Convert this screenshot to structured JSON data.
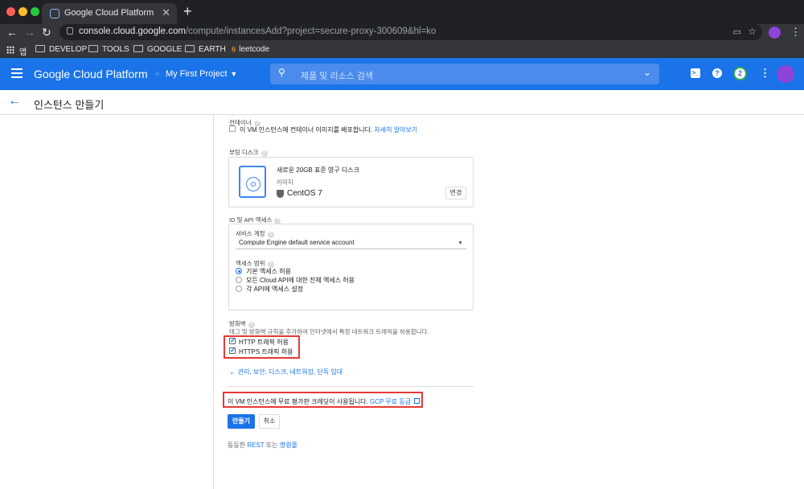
{
  "browser": {
    "tab_title": "Google Cloud Platform",
    "tab_close": "✕",
    "new_tab": "+",
    "url_domain": "console.cloud.google.com",
    "url_path": "/compute/instancesAdd?project=secure-proxy-300609&hl=ko",
    "bookmarks": [
      {
        "label": "앱"
      },
      {
        "label": "DEVELOP"
      },
      {
        "label": "TOOLS"
      },
      {
        "label": "GOOGLE"
      },
      {
        "label": "EARTH"
      },
      {
        "label": "leetcode"
      }
    ]
  },
  "header": {
    "title": "Google Cloud Platform",
    "project": "My First Project",
    "search_placeholder": "제품 및 리소스 검색",
    "notification_count": "2",
    "brand_color": "#1a73e8"
  },
  "page": {
    "title": "인스턴스 만들기"
  },
  "form": {
    "container": {
      "label": "컨테이너",
      "checkbox_text": "이 VM 인스턴스에 컨테이너 이미지를 배포합니다.",
      "learn_more": "자세히 알아보기",
      "checked": false
    },
    "boot_disk": {
      "label": "부팅 디스크",
      "disk_title": "새로운 20GB 표준 영구 디스크",
      "image_label": "이미지",
      "os": "CentOS 7",
      "change_button": "변경"
    },
    "identity": {
      "label": "ID 및 API 액세스",
      "service_account_label": "서비스 계정",
      "service_account_value": "Compute Engine default service account",
      "access_scope_label": "액세스 범위",
      "scopes": [
        {
          "label": "기본 액세스 허용",
          "selected": true
        },
        {
          "label": "모든 Cloud API에 대한 전체 액세스 허용",
          "selected": false
        },
        {
          "label": "각 API에 액세스 설정",
          "selected": false
        }
      ]
    },
    "firewall": {
      "label": "방화벽",
      "description": "태그 및 방화벽 규칙을 추가하여 인터넷에서 특정 네트워크 트래픽을 허용합니다.",
      "http": "HTTP 트래픽 허용",
      "https": "HTTPS 트래픽 허용",
      "http_checked": true,
      "https_checked": true
    },
    "advanced_link": "관리, 보안, 디스크, 네트워킹, 단독 임대",
    "free_trial_text": "이 VM 인스턴스에 무료 평가판 크레딧이 사용됩니다.",
    "free_trial_link": "GCP 무료 등급",
    "create_button": "만들기",
    "cancel_button": "취소",
    "equivalent_prefix": "동등한",
    "rest_link": "REST",
    "equivalent_middle": "또는",
    "command_link": "명령줄"
  }
}
